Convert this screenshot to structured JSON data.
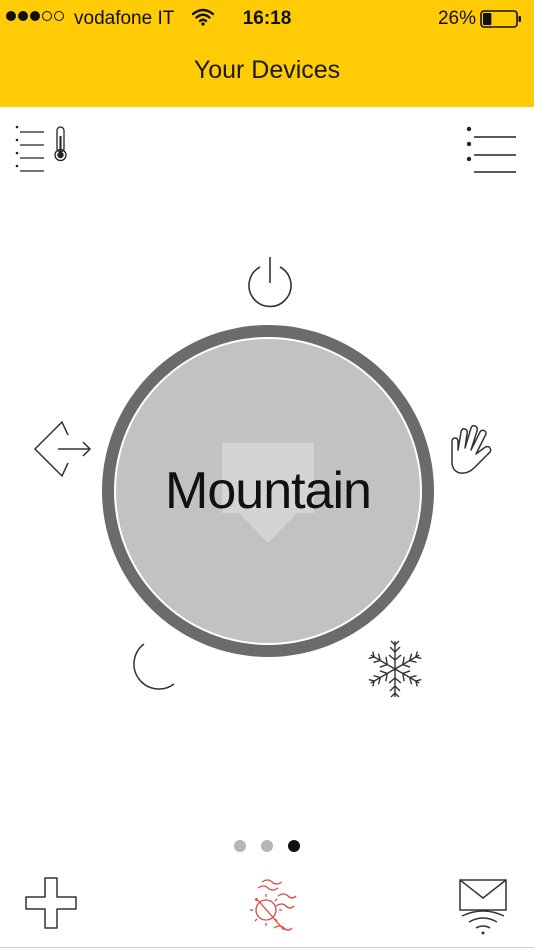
{
  "status_bar": {
    "carrier": "vodafone IT",
    "time": "16:18",
    "battery_percent": "26%",
    "signal_bars_filled": 3,
    "signal_bars_total": 5,
    "battery_level": 0.26
  },
  "header": {
    "title": "Your Devices"
  },
  "toolbar": {
    "left_icon": "sensor-list-thermometer-icon",
    "right_icon": "list-menu-icon"
  },
  "dial": {
    "label": "Mountain",
    "modes": [
      "power-icon",
      "hand-icon",
      "snowflake-icon",
      "moon-icon",
      "enter-icon"
    ]
  },
  "pager": {
    "count": 3,
    "active_index": 2
  },
  "bottom_bar": {
    "left_icon": "plus-icon",
    "center_icon": "sun-heat-icon",
    "right_icon": "mail-wifi-icon",
    "center_color": "#e0473c"
  },
  "colors": {
    "accent": "#ffcb05",
    "dial_ring": "#6b6b6b",
    "dial_face": "#c2c2c2"
  }
}
